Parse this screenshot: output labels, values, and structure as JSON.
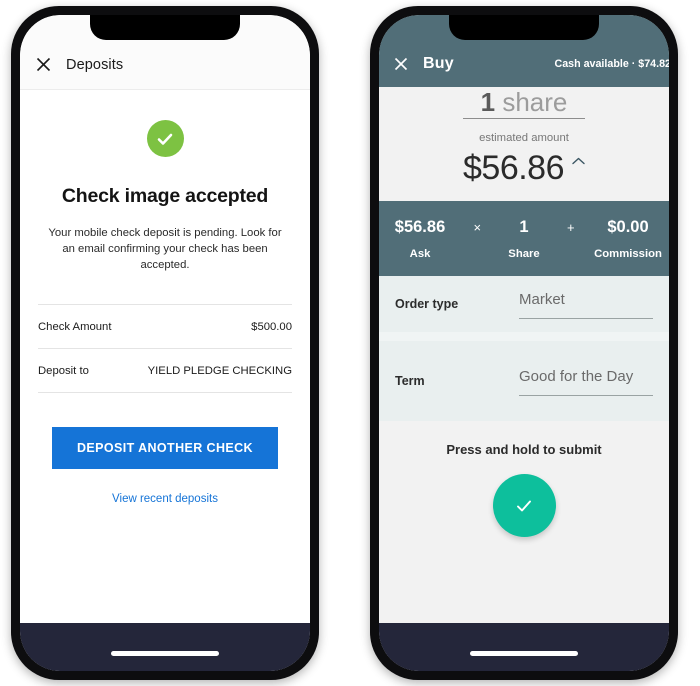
{
  "colors": {
    "slate_header": "#516E78",
    "teal_accent": "#0DBF9C",
    "green_success": "#7DC242",
    "blue_primary": "#1574D7",
    "dark_navbar": "#24263A",
    "field_panel_bg": "#E9EFEF"
  },
  "left_phone": {
    "header": {
      "close_icon": "close-x-icon",
      "title": "Deposits"
    },
    "status_icon": "success-check-circle-icon",
    "success_title": "Check image accepted",
    "success_message": "Your mobile check deposit is pending. Look for an email confirming your check has been accepted.",
    "details": [
      {
        "key": "Check Amount",
        "value": "$500.00"
      },
      {
        "key": "Deposit to",
        "value": "YIELD PLEDGE CHECKING"
      }
    ],
    "primary_button": "DEPOSIT ANOTHER CHECK",
    "link": "View recent deposits",
    "home_indicator": "home-indicator"
  },
  "right_phone": {
    "header": {
      "close_icon": "close-x-icon",
      "title": "Buy",
      "cash_label": "Cash available",
      "cash_separator": "·",
      "cash_value": "$74.82"
    },
    "quantity": {
      "qty": "1",
      "unit": "share"
    },
    "estimate": {
      "label": "estimated amount",
      "amount": "$56.86",
      "caret_icon": "chevron-up-icon"
    },
    "calc": {
      "ask_value": "$56.86",
      "ask_label": "Ask",
      "multiply_op": "×",
      "share_value": "1",
      "share_label": "Share",
      "plus_op": "+",
      "commission_value": "$0.00",
      "commission_label": "Commission"
    },
    "fields": [
      {
        "label": "Order type",
        "value": "Market"
      },
      {
        "label": "Term",
        "value": "Good for the Day"
      }
    ],
    "submit": {
      "hint": "Press and hold to submit",
      "button_icon": "check-mark-icon"
    },
    "home_indicator": "home-indicator"
  }
}
